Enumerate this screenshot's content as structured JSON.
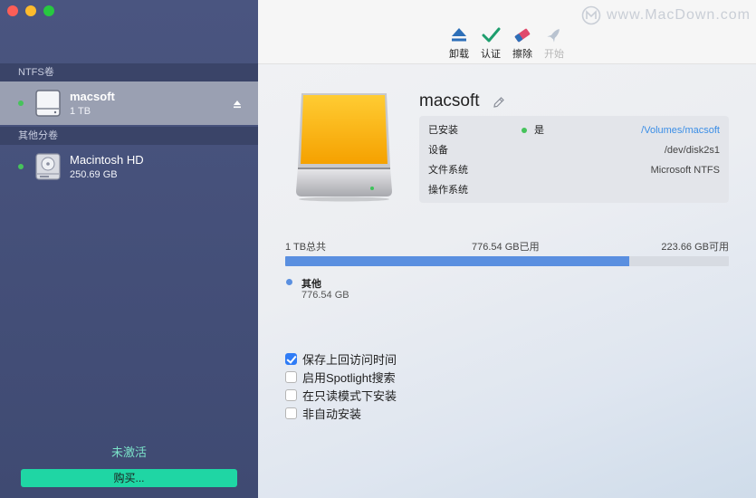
{
  "sidebar": {
    "sections": [
      {
        "label": "NTFS卷",
        "items": [
          {
            "name": "macsoft",
            "size": "1 TB",
            "selected": true,
            "mounted": true
          }
        ]
      },
      {
        "label": "其他分卷",
        "items": [
          {
            "name": "Macintosh HD",
            "size": "250.69 GB",
            "selected": false,
            "mounted": true
          }
        ]
      }
    ],
    "status": "未激活",
    "buy_label": "购买...",
    "colors": {
      "status": "#7be3c9",
      "buy_button": "#1fd6a4",
      "mounted_dot": "#46c35b"
    }
  },
  "toolbar": {
    "unmount_label": "卸载",
    "verify_label": "认证",
    "erase_label": "擦除",
    "start_label": "开始"
  },
  "watermark": "www.MacDown.com",
  "volume": {
    "title": "macsoft",
    "info": {
      "mounted_label": "已安装",
      "mounted_value": "是",
      "mount_path": "/Volumes/macsoft",
      "device_label": "设备",
      "device_value": "/dev/disk2s1",
      "fs_label": "文件系统",
      "fs_value": "Microsoft NTFS",
      "os_label": "操作系统",
      "os_value": ""
    },
    "capacity": {
      "total": "1 TB总共",
      "used": "776.54 GB已用",
      "free": "223.66 GB可用",
      "used_fraction": 0.776
    },
    "legend": {
      "name": "其他",
      "value": "776.54 GB",
      "color": "#5a8fe0"
    }
  },
  "options": [
    {
      "label": "保存上回访问时间",
      "checked": true
    },
    {
      "label": "启用Spotlight搜索",
      "checked": false
    },
    {
      "label": "在只读模式下安装",
      "checked": false
    },
    {
      "label": "非自动安装",
      "checked": false
    }
  ]
}
